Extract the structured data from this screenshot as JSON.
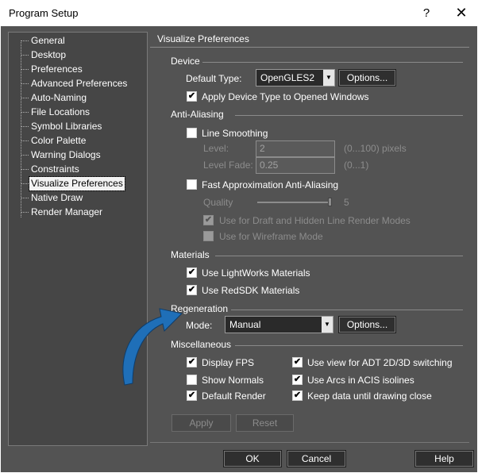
{
  "window": {
    "title": "Program Setup",
    "help_glyph": "?",
    "close_glyph": "✕"
  },
  "tree": {
    "items": [
      {
        "label": "General"
      },
      {
        "label": "Desktop"
      },
      {
        "label": "Preferences"
      },
      {
        "label": "Advanced Preferences"
      },
      {
        "label": "Auto-Naming"
      },
      {
        "label": "File Locations"
      },
      {
        "label": "Symbol Libraries"
      },
      {
        "label": "Color Palette"
      },
      {
        "label": "Warning Dialogs"
      },
      {
        "label": "Constraints"
      },
      {
        "label": "Visualize Preferences",
        "selected": true
      },
      {
        "label": "Native Draw"
      },
      {
        "label": "Render Manager"
      }
    ]
  },
  "panel": {
    "title": "Visualize Preferences",
    "device": {
      "section": "Device",
      "default_type_label": "Default Type:",
      "default_type_value": "OpenGLES2",
      "options_button": "Options...",
      "apply_device_label": "Apply Device Type to Opened Windows",
      "apply_device_checked": true
    },
    "antialiasing": {
      "section": "Anti-Aliasing",
      "line_smoothing_label": "Line Smoothing",
      "line_smoothing_checked": false,
      "level_label": "Level:",
      "level_value": "2",
      "level_range": "(0...100) pixels",
      "level_fade_label": "Level Fade:",
      "level_fade_value": "0.25",
      "level_fade_range": "(0...1)",
      "fast_approx_label": "Fast Approximation Anti-Aliasing",
      "fast_approx_checked": false,
      "quality_label": "Quality",
      "quality_value": "5",
      "quality_fraction": 1.0,
      "draft_hidden_label": "Use for Draft and Hidden Line Render Modes",
      "draft_hidden_checked": true,
      "wireframe_label": "Use for Wireframe Mode",
      "wireframe_checked": false
    },
    "materials": {
      "section": "Materials",
      "lightworks_label": "Use LightWorks Materials",
      "lightworks_checked": true,
      "redsdk_label": "Use RedSDK Materials",
      "redsdk_checked": true
    },
    "regeneration": {
      "section": "Regeneration",
      "mode_label": "Mode:",
      "mode_value": "Manual",
      "options_button": "Options..."
    },
    "misc": {
      "section": "Miscellaneous",
      "display_fps_label": "Display FPS",
      "display_fps_checked": true,
      "show_normals_label": "Show Normals",
      "show_normals_checked": false,
      "default_render_label": "Default Render",
      "default_render_checked": true,
      "adt_switch_label": "Use view for ADT 2D/3D switching",
      "adt_switch_checked": true,
      "arcs_acis_label": "Use Arcs in ACIS isolines",
      "arcs_acis_checked": true,
      "keep_data_label": "Keep data until drawing close",
      "keep_data_checked": true
    },
    "apply_button": "Apply",
    "reset_button": "Reset"
  },
  "footer": {
    "ok": "OK",
    "cancel": "Cancel",
    "help": "Help"
  },
  "annotation": {
    "arrow_color": "#1f6fb8",
    "arrow_icon": "curved-arrow-icon"
  },
  "check_glyph": "✔"
}
